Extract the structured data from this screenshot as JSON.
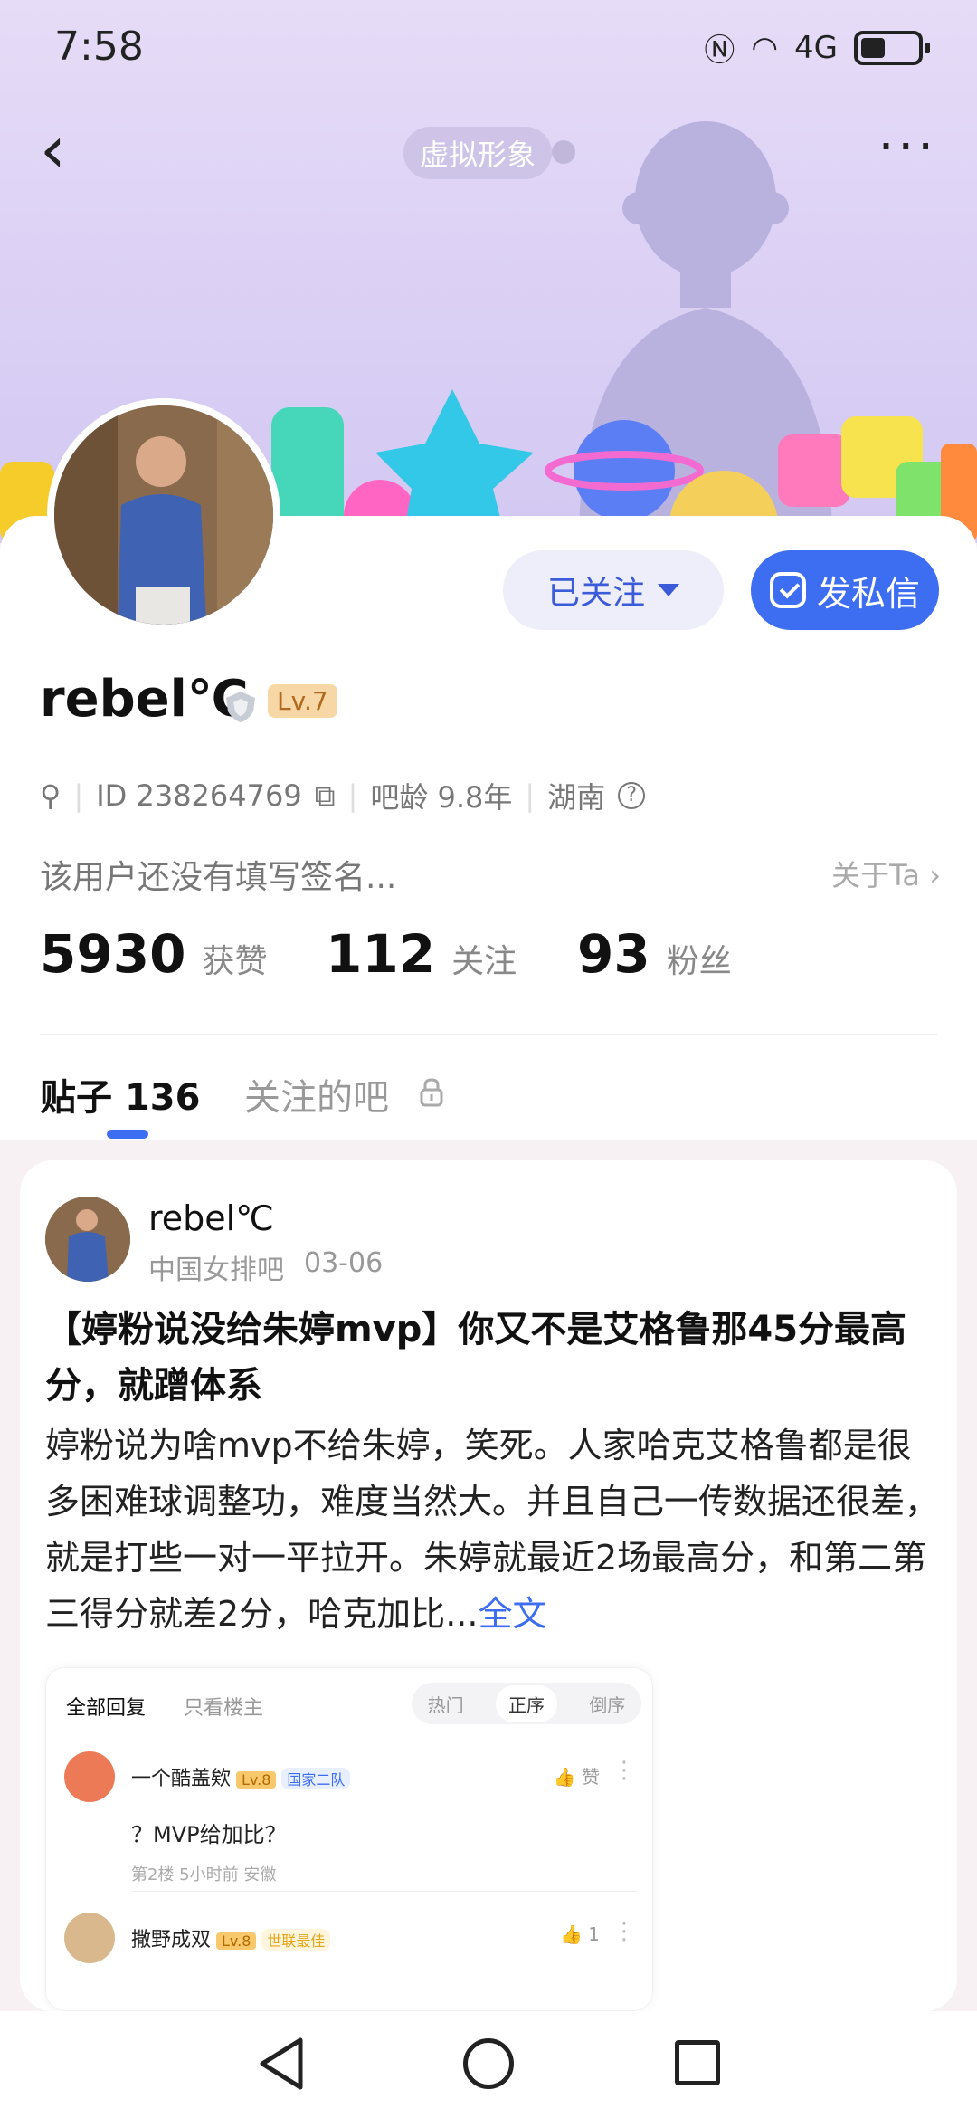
{
  "status_bar": {
    "time": "7:58",
    "network": "4G"
  },
  "header": {
    "virtual_tag": "虚拟形象"
  },
  "profile": {
    "username": "rebel℃",
    "level": "Lv.7",
    "follow_label": "已关注",
    "message_label": "发私信",
    "id_text": "ID 238264769",
    "bar_age": "吧龄 9.8年",
    "region": "湖南",
    "region_help": "?",
    "signature": "该用户还没有填写签名...",
    "about_label": "关于Ta",
    "stats": [
      {
        "value": "5930",
        "label": "获赞"
      },
      {
        "value": "112",
        "label": "关注"
      },
      {
        "value": "93",
        "label": "粉丝"
      }
    ]
  },
  "tabs": {
    "posts_label": "贴子",
    "posts_count": "136",
    "followed_bars": "关注的吧"
  },
  "post": {
    "author": "rebel℃",
    "forum": "中国女排吧",
    "date": "03-06",
    "title": "【婷粉说没给朱婷mvp】你又不是艾格鲁那45分最高分，就蹭体系",
    "body": "婷粉说为啥mvp不给朱婷，笑死。人家哈克艾格鲁都是很多困难球调整功，难度当然大。并且自己一传数据还很差，就是打些一对一平拉开。朱婷就最近2场最高分，和第二第三得分就差2分，哈克加比",
    "ellipsis": "...",
    "full_text": "全文",
    "preview": {
      "tab_all": "全部回复",
      "tab_owner": "只看楼主",
      "sort_hot": "热门",
      "sort_asc": "正序",
      "sort_desc": "倒序",
      "comments": [
        {
          "name": "一个酷盖欸",
          "level": "Lv.8",
          "badge": "国家二队",
          "like": "赞",
          "text": "？MVP给加比？",
          "sub": "第2楼  5小时前  安徽"
        },
        {
          "name": "撒野成双",
          "level": "Lv.8",
          "badge": "世联最佳",
          "like": "1",
          "text": "",
          "sub": ""
        }
      ]
    }
  },
  "colors": {
    "accent": "#3d6df0",
    "banner": "#ddd2f5",
    "level_bg": "#f7d7a6"
  },
  "icons": [
    "back-icon",
    "more-icon",
    "search-icon",
    "copy-icon",
    "help-icon",
    "chevron-right-icon",
    "lock-icon",
    "mail-icon",
    "like-icon"
  ]
}
